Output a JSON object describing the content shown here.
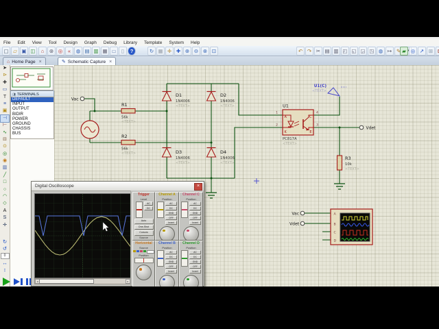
{
  "menu": {
    "items": [
      "File",
      "Edit",
      "View",
      "Tool",
      "Design",
      "Graph",
      "Debug",
      "Library",
      "Template",
      "System",
      "Help"
    ]
  },
  "tabs": {
    "home": {
      "label": "Home Page",
      "close": "×"
    },
    "schematic": {
      "label": "Schematic Capture",
      "close": "×"
    }
  },
  "toolbar": {
    "file_group": [
      {
        "name": "new-project-icon",
        "glyph": "▢",
        "color": "#445566"
      },
      {
        "name": "open-project-icon",
        "glyph": "▱",
        "color": "#C89020"
      },
      {
        "name": "save-project-icon",
        "glyph": "▣",
        "color": "#3858A8"
      },
      {
        "name": "import-project-icon",
        "glyph": "◫",
        "color": "#2E8A2E"
      }
    ],
    "app_group": [
      {
        "name": "home-icon",
        "glyph": "⌂",
        "color": "#B04030"
      },
      {
        "name": "system-settings-icon",
        "glyph": "⊛",
        "color": "#556"
      },
      {
        "name": "record-icon",
        "glyph": "◎",
        "color": "#C03028"
      },
      {
        "name": "rewind-icon",
        "glyph": "«",
        "color": "#B03030"
      },
      {
        "name": "find-icon",
        "glyph": "◍",
        "color": "#3868B8"
      },
      {
        "name": "library-icon",
        "glyph": "▤",
        "color": "#3868A8"
      },
      {
        "name": "notes-icon",
        "glyph": "▥",
        "color": "#2E8A2E"
      },
      {
        "name": "calculator-icon",
        "glyph": "▦",
        "color": "#667"
      },
      {
        "name": "memo-icon",
        "glyph": "▭",
        "color": "#7890B8"
      },
      {
        "name": "page-icon",
        "glyph": "▯",
        "color": "#8899AA"
      },
      {
        "name": "help-icon",
        "glyph": "?",
        "color": "#FFFFFF",
        "cls": "help"
      }
    ],
    "view_group": [
      {
        "name": "redraw-icon",
        "glyph": "↻",
        "color": "#3868B8"
      },
      {
        "name": "grid-toggle-icon",
        "glyph": "▦",
        "color": "#99A0AA"
      },
      {
        "name": "origin-icon",
        "glyph": "✛",
        "color": "#B08020"
      },
      {
        "name": "pan-icon",
        "glyph": "✚",
        "color": "#2858C8"
      },
      {
        "name": "zoom-in-icon",
        "glyph": "⊕",
        "color": "#3868B8"
      },
      {
        "name": "zoom-out-icon",
        "glyph": "⊖",
        "color": "#3868B8"
      },
      {
        "name": "zoom-all-icon",
        "glyph": "⊗",
        "color": "#3868B8"
      },
      {
        "name": "zoom-area-icon",
        "glyph": "⊡",
        "color": "#3868B8"
      }
    ],
    "edit_group": [
      {
        "name": "undo-icon",
        "glyph": "↶",
        "color": "#B08030"
      },
      {
        "name": "redo-icon",
        "glyph": "↷",
        "color": "#B08030"
      },
      {
        "name": "cut-icon",
        "glyph": "✂",
        "color": "#556"
      },
      {
        "name": "copy-icon",
        "glyph": "▤",
        "color": "#556"
      },
      {
        "name": "paste-icon",
        "glyph": "▥",
        "color": "#556"
      },
      {
        "name": "block-copy-icon",
        "glyph": "◰",
        "color": "#667"
      },
      {
        "name": "block-move-icon",
        "glyph": "◱",
        "color": "#667"
      },
      {
        "name": "block-rotate-icon",
        "glyph": "◲",
        "color": "#667"
      },
      {
        "name": "block-delete-icon",
        "glyph": "◳",
        "color": "#667"
      },
      {
        "name": "find-component-icon",
        "glyph": "◍",
        "color": "#3868B8"
      },
      {
        "name": "goto-icon",
        "glyph": "↦",
        "color": "#556"
      },
      {
        "name": "edit-properties-icon",
        "glyph": "✎",
        "color": "#B08030"
      },
      {
        "name": "property-wand-icon",
        "glyph": "↗",
        "color": "#556"
      }
    ],
    "design_group": [
      {
        "name": "highlight-net-icon",
        "glyph": "▰",
        "color": "#2E8A2E",
        "selected": true
      },
      {
        "name": "search-select-icon",
        "glyph": "◎",
        "color": "#2858C8"
      },
      {
        "name": "cross-probe-icon",
        "glyph": "↗",
        "color": "#2858C8"
      },
      {
        "name": "new-sheet-icon",
        "glyph": "⊞",
        "color": "#8899AA"
      },
      {
        "name": "remove-sheet-icon",
        "glyph": "⊠",
        "color": "#A04030"
      },
      {
        "name": "goto-sheet-icon",
        "glyph": "▯",
        "color": "#8899AA"
      }
    ]
  },
  "side_toolbar": {
    "icons": [
      {
        "name": "selection-mode-icon",
        "glyph": "➤",
        "color": "#222"
      },
      {
        "name": "component-mode-icon",
        "glyph": "⊳",
        "color": "#B08A18"
      },
      {
        "name": "junction-dot-mode-icon",
        "glyph": "✚",
        "color": "#333"
      },
      {
        "name": "wire-label-mode-icon",
        "glyph": "▭",
        "color": "#3A5AA8"
      },
      {
        "name": "text-script-mode-icon",
        "glyph": "T",
        "color": "#333"
      },
      {
        "name": "buses-mode-icon",
        "glyph": "≡",
        "color": "#3A5AA8"
      },
      {
        "name": "subcircuit-mode-icon",
        "glyph": "▣",
        "color": "#B08A18"
      },
      {
        "name": "terminals-mode-icon",
        "glyph": "⊣",
        "color": "#3A5AA8",
        "selected": true
      },
      {
        "name": "device-pins-mode-icon",
        "glyph": "⊢",
        "color": "#884444"
      },
      {
        "name": "graph-mode-icon",
        "glyph": "∿",
        "color": "#208020"
      },
      {
        "name": "tape-recorder-mode-icon",
        "glyph": "⊟",
        "color": "#806040"
      },
      {
        "name": "generator-mode-icon",
        "glyph": "⊙",
        "color": "#B08A18"
      },
      {
        "name": "voltage-probe-mode-icon",
        "glyph": "◎",
        "color": "#208020"
      },
      {
        "name": "current-probe-mode-icon",
        "glyph": "◉",
        "color": "#C07818"
      },
      {
        "name": "virtual-instruments-mode-icon",
        "glyph": "▥",
        "color": "#3A5AA8"
      },
      {
        "name": "2d-line-mode-icon",
        "glyph": "╱",
        "color": "#208020"
      },
      {
        "name": "2d-box-mode-icon",
        "glyph": "□",
        "color": "#208020"
      },
      {
        "name": "2d-circle-mode-icon",
        "glyph": "○",
        "color": "#208020"
      },
      {
        "name": "2d-arc-mode-icon",
        "glyph": "◠",
        "color": "#208020"
      },
      {
        "name": "2d-path-mode-icon",
        "glyph": "◇",
        "color": "#208020"
      },
      {
        "name": "2d-text-mode-icon",
        "glyph": "A",
        "color": "#222"
      },
      {
        "name": "2d-symbol-mode-icon",
        "glyph": "S",
        "color": "#223355"
      },
      {
        "name": "2d-marker-mode-icon",
        "glyph": "✛",
        "color": "#223355"
      }
    ]
  },
  "orientation": {
    "rotate_cw": "↻",
    "rotate_ccw": "↺",
    "angle": "0",
    "mirror_h": "↔",
    "mirror_v": "↕"
  },
  "terminals_panel": {
    "title": "TERMINALS",
    "items": [
      {
        "label": "DEFAULT",
        "selected": true
      },
      {
        "label": "INPUT"
      },
      {
        "label": "OUTPUT"
      },
      {
        "label": "BIDIR"
      },
      {
        "label": "POWER"
      },
      {
        "label": "GROUND"
      },
      {
        "label": "CHASSIS"
      },
      {
        "label": "BUS"
      }
    ]
  },
  "schematic": {
    "wire_color": "#0B5210",
    "component_color": "#A61B1B",
    "vac_terminal": "Vac",
    "vdet_terminal": "Vdet",
    "u1c_terminal": {
      "label": "U1(C)",
      "text": "<TEXT>"
    },
    "r1": {
      "ref": "R1",
      "value": "56k",
      "text": "<TEXT>"
    },
    "r2": {
      "ref": "R2",
      "value": "56k",
      "text": "<TEXT>"
    },
    "r3": {
      "ref": "R3",
      "value": "10k",
      "text": "<TEXT>"
    },
    "d1": {
      "ref": "D1",
      "value": "1N4006",
      "text": "<TEXT>"
    },
    "d2": {
      "ref": "D2",
      "value": "1N4006",
      "text": "<TEXT>"
    },
    "d3": {
      "ref": "D3",
      "value": "1N4006",
      "text": "<TEXT>"
    },
    "d4": {
      "ref": "D4",
      "value": "1N4006",
      "text": "<TEXT>"
    },
    "u1": {
      "ref": "U1",
      "value": "PC817A",
      "text": "<TEXT>",
      "pin1": "1",
      "pin2": "2",
      "pin3": "3",
      "pin4": "4",
      "pin_a": "A",
      "pin_k": "K",
      "pin_c": "C",
      "pin_e": "E"
    },
    "probe_vac": "Vac",
    "probe_vdet": "Vdet",
    "scope_pin_a": "A",
    "scope_pin_b": "B",
    "scope_pin_c": "C",
    "scope_pin_d": "D"
  },
  "oscilloscope": {
    "title": "Digital Oscilloscope",
    "close": "×",
    "screen": {
      "channel_a_trace": "#B9B972",
      "channel_b_trace": "#5A79E0"
    },
    "trigger": {
      "label": "Trigger",
      "color": "#C03028",
      "level": "Level",
      "ac": "AC",
      "dc": "DC",
      "buttons": [
        "Auto",
        "One-Shot",
        "Cursors"
      ],
      "source": "Source"
    },
    "horizontal": {
      "label": "Horizontal",
      "color": "#C87820",
      "source": "Source",
      "position": "Position"
    },
    "channels": [
      {
        "label": "Channel A",
        "color": "#B89B00",
        "position": "Position",
        "buttons": [
          "AC",
          "DC",
          "GND",
          "OFF",
          "Invert"
        ]
      },
      {
        "label": "Channel B",
        "color": "#3E62C8",
        "position": "Position",
        "buttons": [
          "AC",
          "DC",
          "GND",
          "OFF",
          "Invert"
        ]
      },
      {
        "label": "Channel C",
        "color": "#C84868",
        "position": "Position",
        "buttons": [
          "AC",
          "DC",
          "GND",
          "OFF",
          "Invert"
        ]
      },
      {
        "label": "Channel D",
        "color": "#2E9A2E",
        "position": "Position",
        "buttons": [
          "AC",
          "DC",
          "GND",
          "OFF",
          "Invert"
        ]
      }
    ]
  }
}
